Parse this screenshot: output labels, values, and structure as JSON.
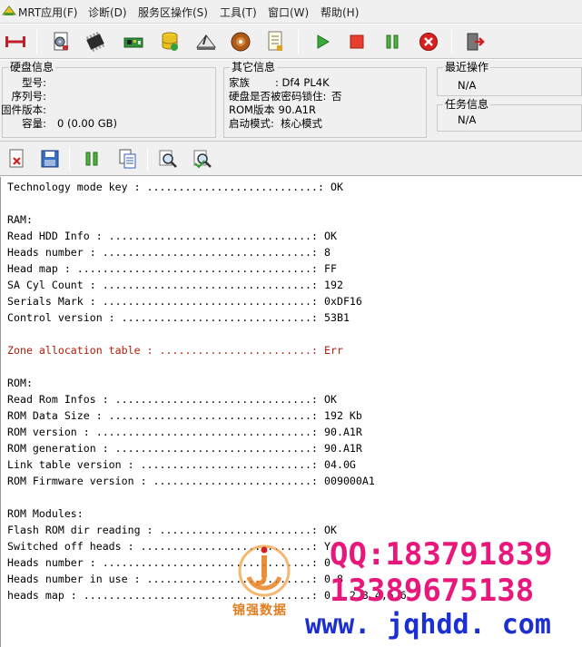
{
  "menubar": {
    "items": [
      {
        "label": "MRT应用(F)"
      },
      {
        "label": "诊断(D)"
      },
      {
        "label": "服务区操作(S)"
      },
      {
        "label": "工具(T)"
      },
      {
        "label": "窗口(W)"
      },
      {
        "label": "帮助(H)"
      }
    ]
  },
  "toolbar": {
    "icons": [
      "connect-icon",
      "disk-report-icon",
      "chip-icon",
      "pcb-board-icon",
      "database-icon",
      "disk-platter-icon",
      "hdd-head-icon",
      "notes-icon",
      "start-icon",
      "stop-icon",
      "pause-icon",
      "cancel-icon",
      "exit-icon"
    ]
  },
  "disk_info": {
    "title": "硬盘信息",
    "model_label": "型号:",
    "model_value": "",
    "serial_label": "序列号:",
    "serial_value": "",
    "firmware_label": "固件版本:",
    "firmware_value": "",
    "capacity_label": "容量:",
    "capacity_value": "0 (0.00 GB)"
  },
  "other_info": {
    "title": "其它信息",
    "family_label": "家族",
    "family_value": ": Df4 PL4K",
    "lock_label": "硬盘是否被密码锁住:",
    "lock_value": "否",
    "rom_label": "ROM版本",
    "rom_value": ": 90.A1R",
    "boot_label": "启动模式:",
    "boot_value": "核心模式"
  },
  "recent_ops": {
    "title": "最近操作",
    "value": "N/A"
  },
  "task_info": {
    "title": "任务信息",
    "value": "N/A"
  },
  "toolbar2": {
    "icons": [
      "clear-log-icon",
      "save-log-icon",
      "pause-icon",
      "copy-icon",
      "search-icon",
      "search-next-icon"
    ]
  },
  "log": {
    "lines": [
      {
        "text": "Technology mode key : ...........................: OK",
        "color": "#000000"
      },
      {
        "text": "",
        "color": "#000000"
      },
      {
        "text": "RAM:",
        "color": "#000000"
      },
      {
        "text": "Read HDD Info : ................................: OK",
        "color": "#000000"
      },
      {
        "text": "Heads number : .................................: 8",
        "color": "#000000"
      },
      {
        "text": "Head map : .....................................: FF",
        "color": "#000000"
      },
      {
        "text": "SA Cyl Count : .................................: 192",
        "color": "#000000"
      },
      {
        "text": "Serials Mark : .................................: 0xDF16",
        "color": "#000000"
      },
      {
        "text": "Control version : ..............................: 53B1",
        "color": "#000000"
      },
      {
        "text": "",
        "color": "#000000"
      },
      {
        "text": "Zone allocation table : ........................: Err",
        "color": "#b01d0a"
      },
      {
        "text": "",
        "color": "#000000"
      },
      {
        "text": "ROM:",
        "color": "#000000"
      },
      {
        "text": "Read Rom Infos : ...............................: OK",
        "color": "#000000"
      },
      {
        "text": "ROM Data Size : ................................: 192 Kb",
        "color": "#000000"
      },
      {
        "text": "ROM version : ..................................: 90.A1R",
        "color": "#000000"
      },
      {
        "text": "ROM generation : ...............................: 90.A1R",
        "color": "#000000"
      },
      {
        "text": "Link table version : ...........................: 04.0G",
        "color": "#000000"
      },
      {
        "text": "ROM Firmware version : .........................: 009000A1",
        "color": "#000000"
      },
      {
        "text": "",
        "color": "#000000"
      },
      {
        "text": "ROM Modules:",
        "color": "#000000"
      },
      {
        "text": "Flash ROM dir reading : ........................: OK",
        "color": "#000000"
      },
      {
        "text": "Switched off heads : ...........................: Y",
        "color": "#000000"
      },
      {
        "text": "Heads number : .................................: 0",
        "color": "#000000"
      },
      {
        "text": "Heads number in use : ..........................: 0 8",
        "color": "#000000"
      },
      {
        "text": "heads map : ....................................: 0 1,2,3,4,5,6,",
        "color": "#000000"
      }
    ]
  },
  "watermark": {
    "brand": "锦强数据",
    "qq": "QQ:183791839",
    "phone": "13389675138",
    "url": "www. jqhdd. com",
    "colors": {
      "qq": "#e8177b",
      "url": "#1c2fd0",
      "brand": "#e27d20"
    }
  }
}
